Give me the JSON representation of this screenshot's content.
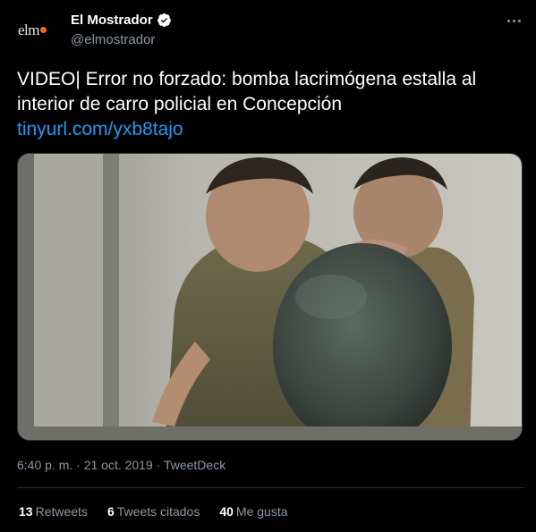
{
  "author": {
    "avatar_text": "elm",
    "display_name": "El Mostrador",
    "handle": "@elmostrador",
    "verified": true
  },
  "tweet": {
    "text": "VIDEO| Error no forzado: bomba lacrimógena estalla al interior de carro policial en Concepción",
    "link": "tinyurl.com/yxb8tajo",
    "media_description": "video-frame-two-men-bending-over-dome"
  },
  "meta": {
    "timestamp": "6:40 p. m. · 21 oct. 2019 · TweetDeck"
  },
  "stats": [
    {
      "count": "13",
      "label": "Retweets"
    },
    {
      "count": "6",
      "label": "Tweets citados"
    },
    {
      "count": "40",
      "label": "Me gusta"
    }
  ],
  "colors": {
    "background": "#000000",
    "link": "#1d9bf0",
    "muted": "#8b98a5",
    "avatar_dot": "#f06a22",
    "verified": "#ffffff"
  }
}
